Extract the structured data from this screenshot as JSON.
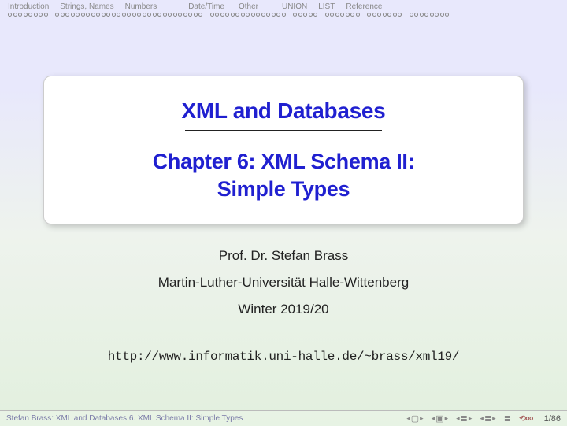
{
  "nav": {
    "items": [
      "Introduction",
      "Strings, Names",
      "Numbers",
      "Date/Time",
      "Other",
      "UNION",
      "LIST",
      "Reference"
    ],
    "dotcounts": [
      8,
      29,
      15,
      5,
      7,
      7,
      8
    ]
  },
  "card": {
    "title": "XML and Databases",
    "subtitle_l1": "Chapter 6: XML Schema II:",
    "subtitle_l2": "Simple Types"
  },
  "body": {
    "author": "Prof. Dr. Stefan Brass",
    "affiliation": "Martin-Luther-Universität Halle-Wittenberg",
    "term": "Winter 2019/20",
    "url": "http://www.informatik.uni-halle.de/~brass/xml19/"
  },
  "footer": {
    "left": "Stefan Brass:    XML and Databases  6. XML Schema II: Simple Types",
    "page": "1/86"
  }
}
